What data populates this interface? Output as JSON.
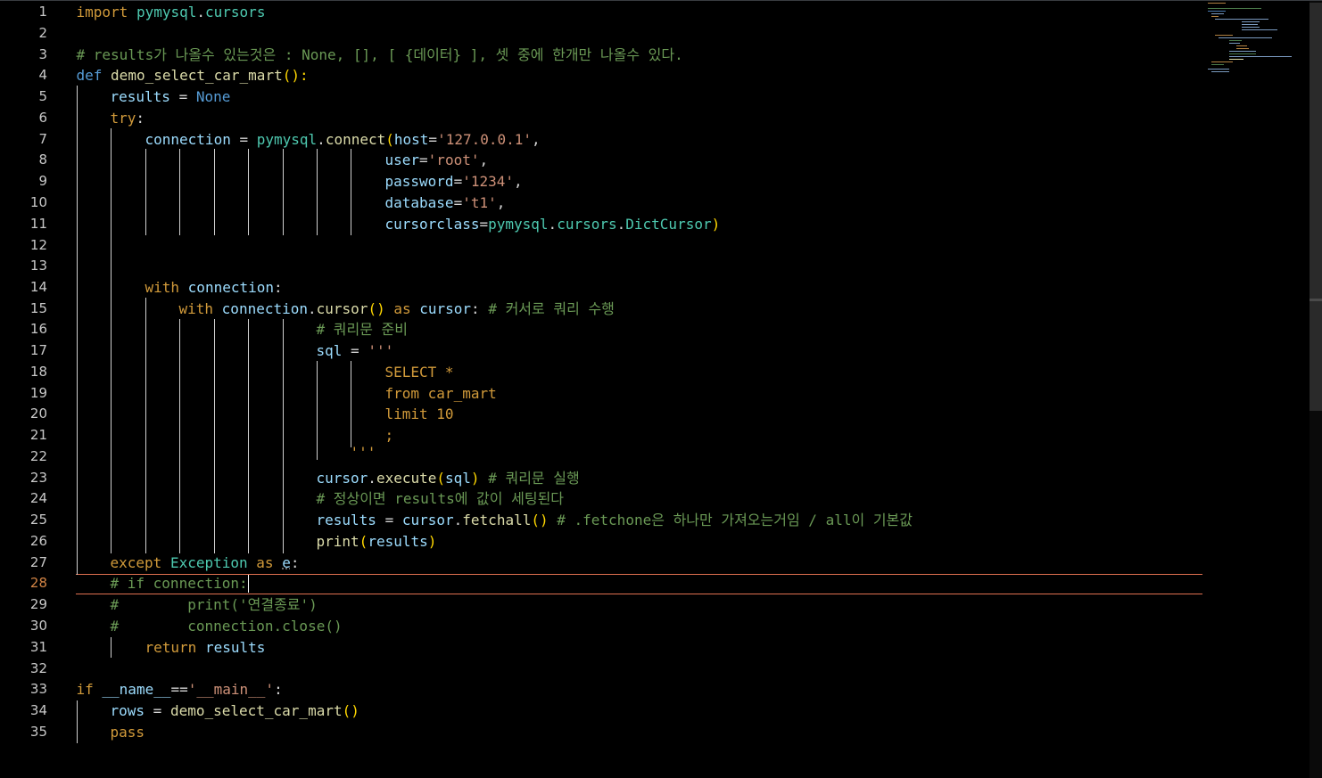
{
  "line_numbers": [
    "1",
    "2",
    "3",
    "4",
    "5",
    "6",
    "7",
    "8",
    "9",
    "10",
    "11",
    "12",
    "13",
    "14",
    "15",
    "16",
    "17",
    "18",
    "19",
    "20",
    "21",
    "22",
    "23",
    "24",
    "25",
    "26",
    "27",
    "28",
    "29",
    "30",
    "31",
    "32",
    "33",
    "34",
    "35"
  ],
  "code": {
    "l1": [
      "import",
      " ",
      "pymysql",
      ".",
      "cursors"
    ],
    "l3": "# results가 나올수 있는것은 : None, [], [ {데이터} ], 셋 중에 한개만 나올수 있다.",
    "l4": [
      "def",
      " ",
      "demo_select_car_mart",
      "():"
    ],
    "l5": [
      "results",
      " = ",
      "None"
    ],
    "l6": [
      "try",
      ":"
    ],
    "l7": [
      "connection",
      " = ",
      "pymysql",
      ".",
      "connect",
      "(",
      "host",
      "=",
      "'127.0.0.1'",
      ","
    ],
    "l8": [
      "user",
      "=",
      "'root'",
      ","
    ],
    "l9": [
      "password",
      "=",
      "'1234'",
      ","
    ],
    "l10": [
      "database",
      "=",
      "'t1'",
      ","
    ],
    "l11": [
      "cursorclass",
      "=",
      "pymysql",
      ".",
      "cursors",
      ".",
      "DictCursor",
      ")"
    ],
    "l14": [
      "with",
      " ",
      "connection",
      ":"
    ],
    "l15": [
      "with",
      " ",
      "connection",
      ".",
      "cursor",
      "()",
      " ",
      "as",
      " ",
      "cursor",
      ": ",
      "# 커서로 쿼리 수행"
    ],
    "l16": "# 쿼리문 준비",
    "l17": [
      "sql",
      " = ",
      "'''"
    ],
    "l18": "SELECT *",
    "l19": "from car_mart",
    "l20": "limit 10",
    "l21": ";",
    "l22": "'''",
    "l23": [
      "cursor",
      ".",
      "execute",
      "(",
      "sql",
      ")",
      " ",
      "# 쿼리문 실행"
    ],
    "l24": "# 정상이면 results에 값이 세팅된다",
    "l25": [
      "results",
      " = ",
      "cursor",
      ".",
      "fetchall",
      "()",
      " ",
      "# .fetchone은 하나만 가져오는거임 / all이 기본값"
    ],
    "l26": [
      "print",
      "(",
      "results",
      ")"
    ],
    "l27": [
      "except",
      " ",
      "Exception",
      " ",
      "as",
      " ",
      "e",
      ":"
    ],
    "l28": "# if connection:",
    "l29": [
      "#",
      "        print('연결종료')"
    ],
    "l30": [
      "#",
      "        connection.close()"
    ],
    "l31": [
      "return",
      " ",
      "results"
    ],
    "l33": [
      "if",
      " ",
      "__name__",
      "==",
      "'__main__'",
      ":"
    ],
    "l34": [
      "rows",
      " = ",
      "demo_select_car_mart",
      "()"
    ],
    "l35": "pass"
  },
  "colors": {
    "keyword": "#d19a3a",
    "builtin": "#569cd6",
    "variable": "#9cdcfe",
    "function": "#dcdcaa",
    "module": "#4ec9b0",
    "string": "#ce9178",
    "comment": "#6a9955",
    "bracket": "#ffd700",
    "current_line_border": "#e07050",
    "active_line_number": "#d28445"
  }
}
